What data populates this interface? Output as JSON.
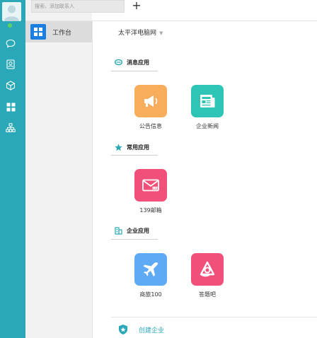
{
  "search": {
    "placeholder": "搜索、添加联系人"
  },
  "toolbar": {
    "add_label": "+"
  },
  "sidebar": {
    "workspace_label": "工作台",
    "rail_icons": [
      "chat-icon",
      "contacts-icon",
      "cube-icon",
      "apps-grid-icon",
      "org-chart-icon"
    ]
  },
  "header": {
    "org_name": "太平洋电脑网",
    "caret": "▼"
  },
  "sections": [
    {
      "title": "消息应用",
      "icon": "message-section-icon",
      "apps": [
        {
          "label": "公告信息",
          "icon": "megaphone-icon",
          "color": "#f7ad5c"
        },
        {
          "label": "企业新闻",
          "icon": "newspaper-icon",
          "color": "#2ec4b6"
        }
      ]
    },
    {
      "title": "常用应用",
      "icon": "star-icon",
      "apps": [
        {
          "label": "139邮箱",
          "icon": "mail-139-icon",
          "color": "#f0507a"
        }
      ]
    },
    {
      "title": "企业应用",
      "icon": "building-icon",
      "apps": [
        {
          "label": "商旅100",
          "icon": "airplane-icon",
          "color": "#5eaaf5"
        },
        {
          "label": "答题吧",
          "icon": "quiz-icon",
          "color": "#f0507a"
        }
      ]
    }
  ],
  "footer": {
    "create_label": "创建企业"
  },
  "colors": {
    "rail": "#2aa8b8",
    "accent": "#2aa8b8",
    "workspace_icon": "#1a7fe0"
  }
}
